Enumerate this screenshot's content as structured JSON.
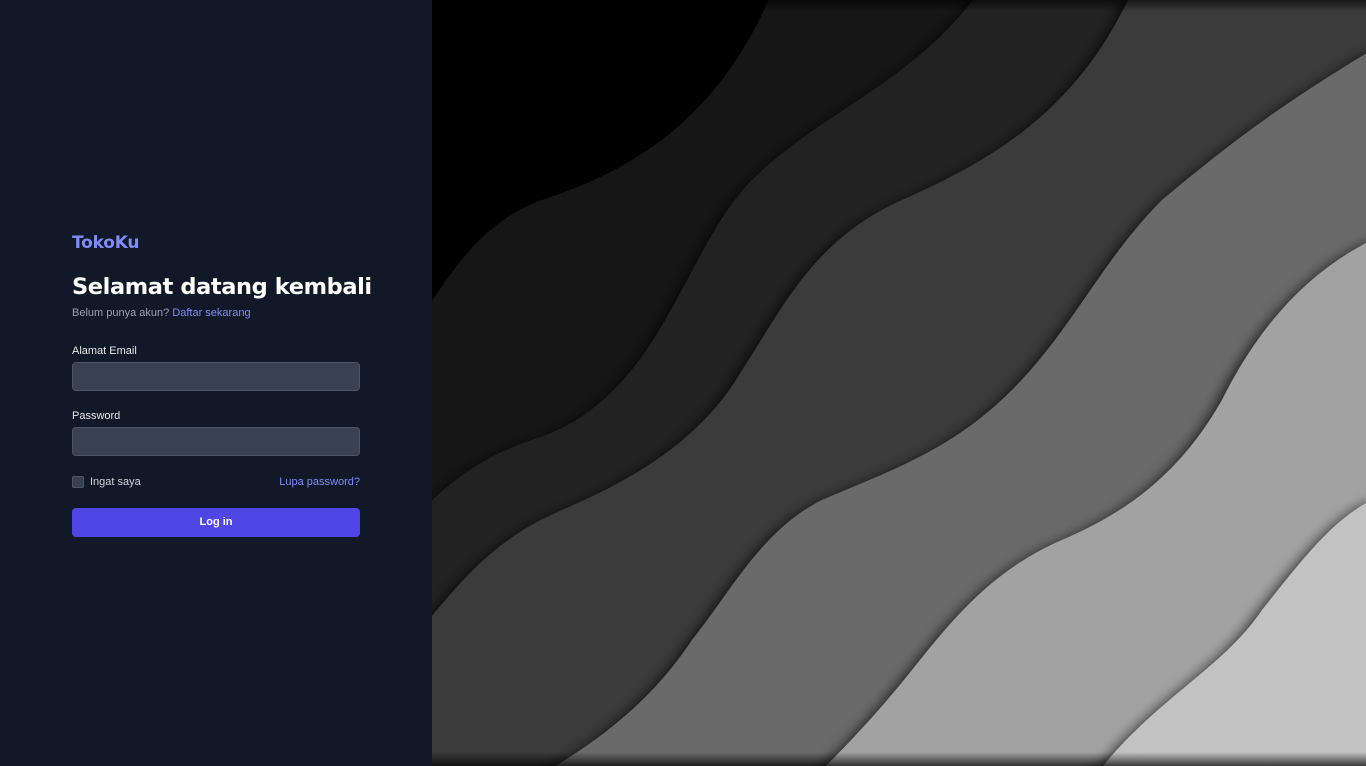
{
  "brand": {
    "name": "TokoKu"
  },
  "login": {
    "title": "Selamat datang kembali",
    "no_account_text": "Belum punya akun?",
    "register_link": "Daftar sekarang",
    "email_label": "Alamat Email",
    "email_value": "",
    "password_label": "Password",
    "password_value": "",
    "remember_label": "Ingat saya",
    "remember_checked": false,
    "forgot_link": "Lupa password?",
    "submit_label": "Log in"
  },
  "hero": {
    "image": "abstract-grayscale-waves"
  },
  "colors": {
    "panel_bg": "#111827",
    "accent": "#4f46e5",
    "link": "#818cf8",
    "input_bg": "#374151"
  }
}
